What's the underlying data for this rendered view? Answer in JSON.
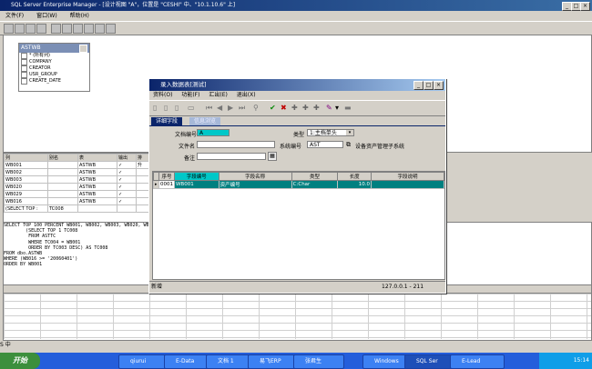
{
  "app": {
    "title": "SQL Server Enterprise Manager - [设计视图 \"A\"，位置是 \"CESHI\" 中、\"10.1.10.6\" 上]",
    "menu": [
      "文件(F)",
      "窗口(W)",
      "帮助(H)"
    ]
  },
  "diagram": {
    "table_name": "ASTWB",
    "columns": [
      "* (所有列)",
      "COMPANY",
      "CREATOR",
      "USR_GROUP",
      "CREATE_DATE"
    ]
  },
  "grid": {
    "headers": [
      "列",
      "别名",
      "表",
      "输出",
      "排"
    ],
    "rows": [
      [
        "WB001",
        "",
        "ASTWB",
        "✓",
        "升"
      ],
      [
        "WB002",
        "",
        "ASTWB",
        "✓",
        ""
      ],
      [
        "WB003",
        "",
        "ASTWB",
        "✓",
        ""
      ],
      [
        "WB020",
        "",
        "ASTWB",
        "✓",
        ""
      ],
      [
        "WB029",
        "",
        "ASTWB",
        "✓",
        ""
      ],
      [
        "WB016",
        "",
        "ASTWB",
        "✓",
        ""
      ],
      [
        "(SELECT TOP :",
        "TC008",
        "",
        "",
        ""
      ]
    ]
  },
  "sql": {
    "lines": [
      "SELECT TOP 100 PERCENT WB001, WB002, WB003, WB020, WB",
      "        (SELECT TOP 1 TC008",
      "         FROM ASTTC",
      "         WHERE TC004 = WB001",
      "         ORDER BY TC003 DESC) AS TC008",
      "FROM dbo.ASTWB",
      "WHERE (WB016 >= '20060401')",
      "ORDER BY WB001"
    ]
  },
  "dialog": {
    "title": "录入数据表[测试]",
    "menu": [
      "资料(O)",
      "功能(F)",
      "汇出(E)",
      "退出(X)"
    ],
    "tabs": [
      "详细字段",
      "信息浏览"
    ],
    "form": {
      "doc_no_label": "文档编号",
      "doc_no_value": "A",
      "type_label": "类型",
      "type_value": "1:主档单头",
      "file_name_label": "文件名",
      "file_name_value": "",
      "sys_no_label": "系统编号",
      "sys_no_value": "AST",
      "sys_name": "设备资产管理子系统",
      "remark_label": "备注",
      "remark_value": ""
    },
    "table": {
      "headers": [
        "序号",
        "字段编号",
        "字段名称",
        "类型",
        "长度",
        "字段说明"
      ],
      "rows": [
        [
          "0001",
          "WB001",
          "资产编号",
          "C:Char",
          "10.0",
          ""
        ]
      ]
    },
    "status": {
      "mode": "新增",
      "ip": "127.0.0.1 - 211"
    }
  },
  "taskbar": {
    "start": "开始",
    "ime": "中",
    "items": [
      "qiurui",
      "E-Data",
      "文档 1",
      "易飞ERP",
      "张君生",
      "Windows",
      "SQL Ser",
      "E-Lead"
    ],
    "clock": "15:14"
  }
}
